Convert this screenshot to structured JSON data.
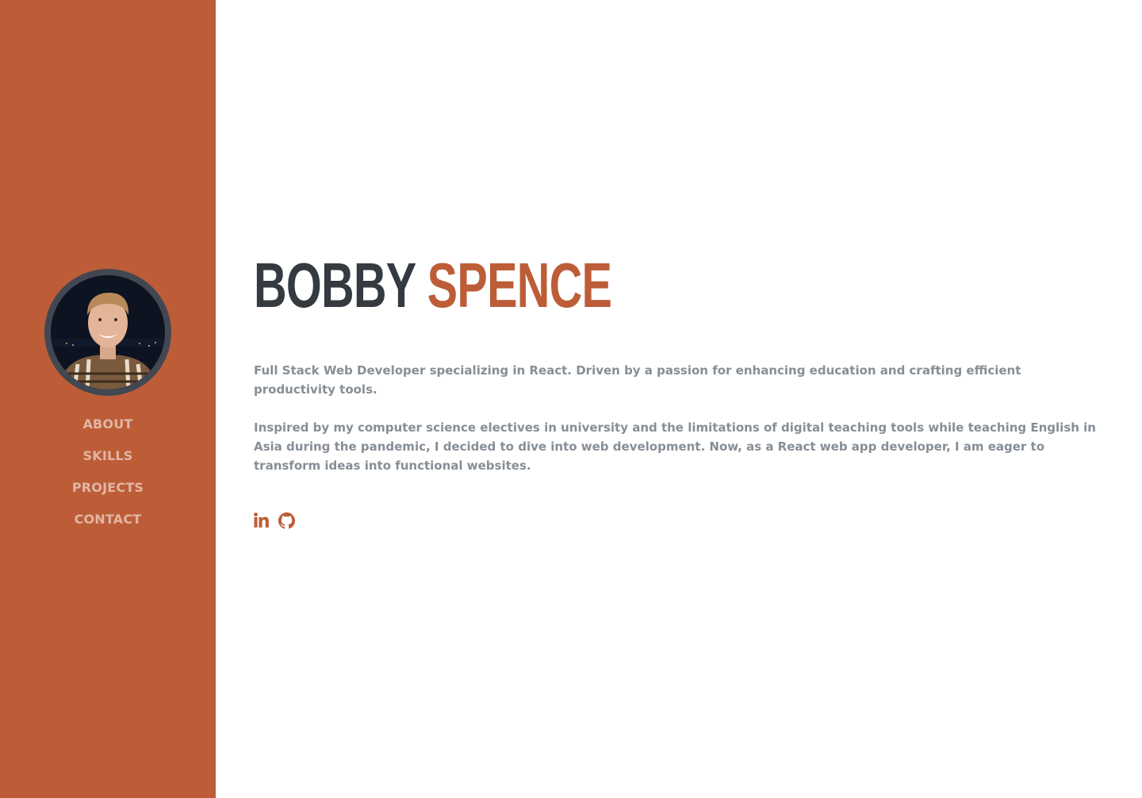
{
  "sidebar": {
    "avatar_alt": "Bobby Spence",
    "nav": [
      {
        "label": "ABOUT"
      },
      {
        "label": "SKILLS"
      },
      {
        "label": "PROJECTS"
      },
      {
        "label": "CONTACT"
      }
    ]
  },
  "main": {
    "first_name": "BOBBY",
    "last_name": "SPENCE",
    "lead": "Full Stack Web Developer specializing in React. Driven by a passion for enhancing education and crafting efficient productivity tools.",
    "bio": "Inspired by my computer science electives in university and the limitations of digital teaching tools while teaching English in Asia during the pandemic, I decided to dive into web development. Now, as a React web app developer, I am eager to transform ideas into functional websites.",
    "socials": [
      {
        "icon": "linkedin-icon"
      },
      {
        "icon": "github-icon"
      }
    ]
  },
  "colors": {
    "accent": "#bd5d37",
    "heading": "#343a40",
    "body_text": "#868e96",
    "background": "#ffffff"
  }
}
